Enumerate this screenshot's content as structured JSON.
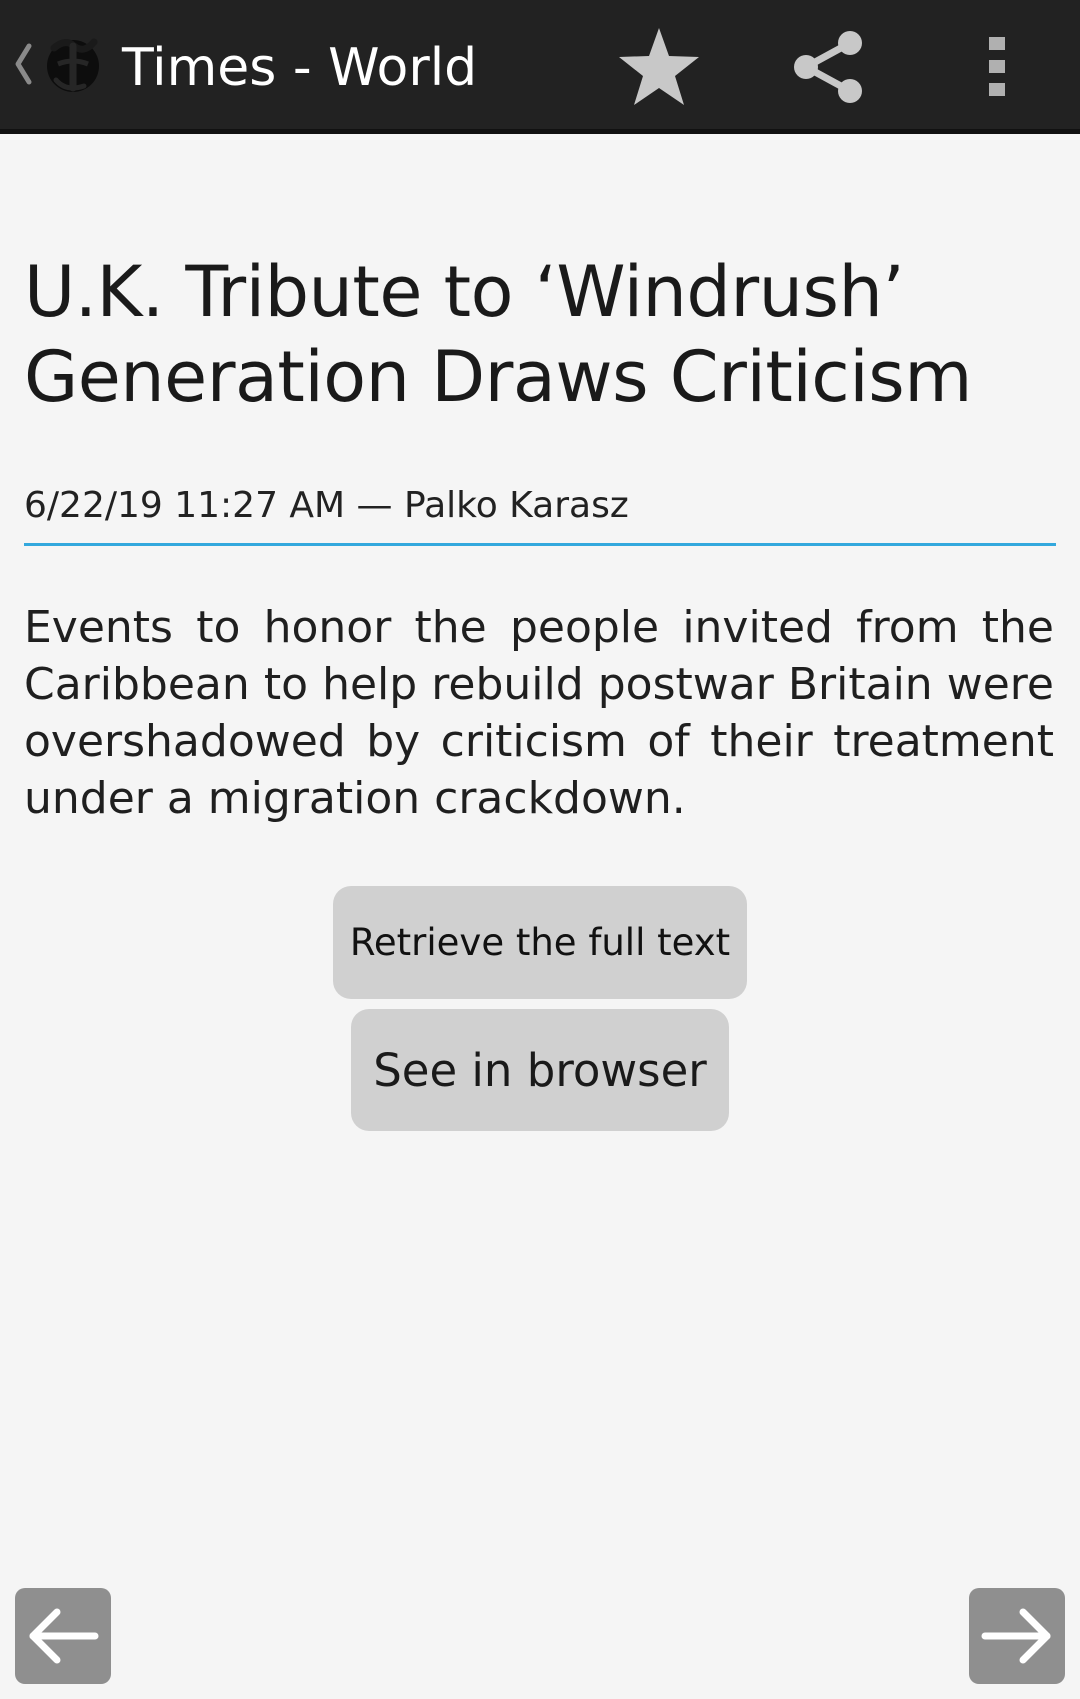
{
  "actionbar": {
    "title": "Times - World",
    "logo_icon": "nyt-gothic-t-icon",
    "up_icon": "chevron-left-icon",
    "actions": [
      {
        "name": "favorite",
        "icon": "star-icon"
      },
      {
        "name": "share",
        "icon": "share-icon"
      },
      {
        "name": "more",
        "icon": "overflow-menu-icon"
      }
    ],
    "background_color": "#222222"
  },
  "article": {
    "title": "U.K. Tribute to ‘Windrush’ Generation Draws Criticism",
    "meta": "6/22/19 11:27 AM — Palko Karasz",
    "summary": "Events to honor the people invited from the Caribbean to help rebuild postwar Britain were overshadowed by criticism of their treatment under a migration crackdown.",
    "divider_color": "#33a8dd"
  },
  "buttons": {
    "retrieve_full_text": "Retrieve the full text",
    "see_in_browser": "See in browser"
  },
  "bottom_nav": {
    "prev_icon": "arrow-left-icon",
    "next_icon": "arrow-right-icon"
  }
}
